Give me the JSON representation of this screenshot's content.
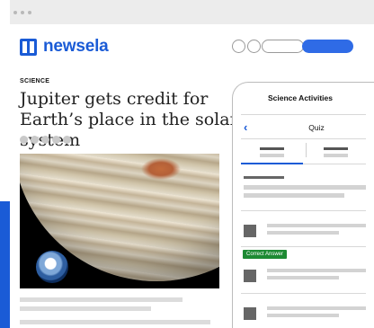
{
  "brand": {
    "name": "newsela",
    "accent_color": "#1a5bd6",
    "cta_color": "#2f6be6",
    "correct_color": "#1d8a33"
  },
  "article": {
    "category": "SCIENCE",
    "headline": "Jupiter gets credit for Earth’s place in the solar system"
  },
  "panel": {
    "title": "Science Activities",
    "back_icon": "‹",
    "section_label": "Quiz",
    "correct_badge": "Correct Answer"
  }
}
